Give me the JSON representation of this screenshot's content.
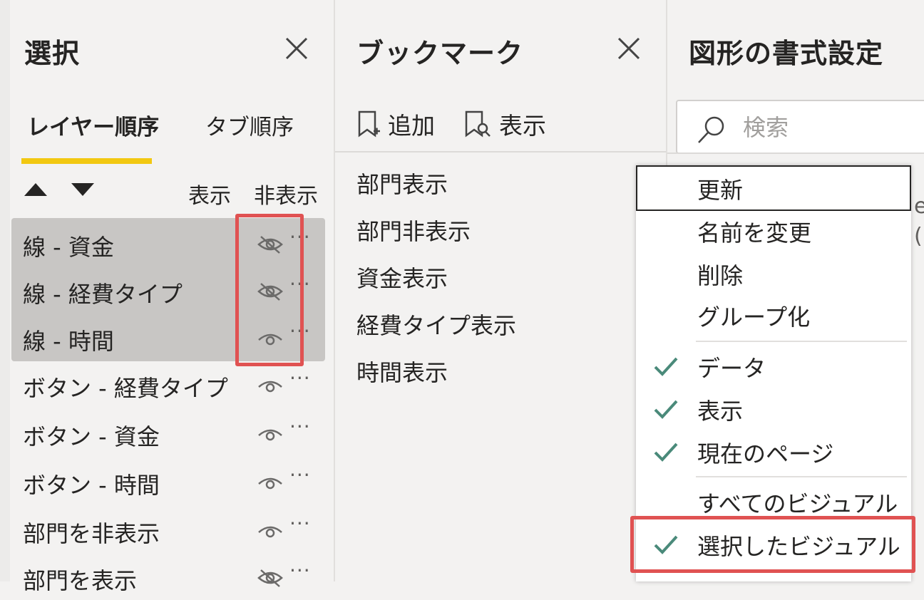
{
  "selection_pane": {
    "title": "選択",
    "tabs": [
      {
        "label": "レイヤー順序",
        "active": true
      },
      {
        "label": "タブ順序",
        "active": false
      }
    ],
    "column_show": "表示",
    "column_hide": "非表示",
    "layers": [
      {
        "label": "線 - 資金",
        "visible": false,
        "selected": true
      },
      {
        "label": "線 - 経費タイプ",
        "visible": false,
        "selected": true
      },
      {
        "label": "線 - 時間",
        "visible": true,
        "selected": true
      },
      {
        "label": "ボタン - 経費タイプ",
        "visible": true,
        "selected": false
      },
      {
        "label": "ボタン - 資金",
        "visible": true,
        "selected": false
      },
      {
        "label": "ボタン - 時間",
        "visible": true,
        "selected": false
      },
      {
        "label": "部門を非表示",
        "visible": true,
        "selected": false
      },
      {
        "label": "部門を表示",
        "visible": false,
        "selected": false
      }
    ],
    "more_glyph": "···"
  },
  "bookmarks_pane": {
    "title": "ブックマーク",
    "add_label": "追加",
    "view_label": "表示",
    "items": [
      "部門表示",
      "部門非表示",
      "資金表示",
      "経費タイプ表示",
      "時間表示"
    ]
  },
  "format_pane": {
    "title": "図形の書式設定",
    "search_placeholder": "検索",
    "behind_text_1": "e",
    "behind_text_2": "("
  },
  "context_menu": {
    "items": [
      {
        "label": "更新",
        "checked": false
      },
      {
        "label": "名前を変更",
        "checked": false
      },
      {
        "label": "削除",
        "checked": false
      },
      {
        "label": "グループ化",
        "checked": false
      },
      {
        "label": "データ",
        "checked": true
      },
      {
        "label": "表示",
        "checked": true
      },
      {
        "label": "現在のページ",
        "checked": true
      },
      {
        "label": "すべてのビジュアル",
        "checked": false
      },
      {
        "label": "選択したビジュアル",
        "checked": true
      }
    ]
  },
  "colors": {
    "accent_underline": "#f2c811",
    "highlight_box": "#e05252",
    "check": "#4a8a7a",
    "selected_row": "#c8c6c4"
  }
}
